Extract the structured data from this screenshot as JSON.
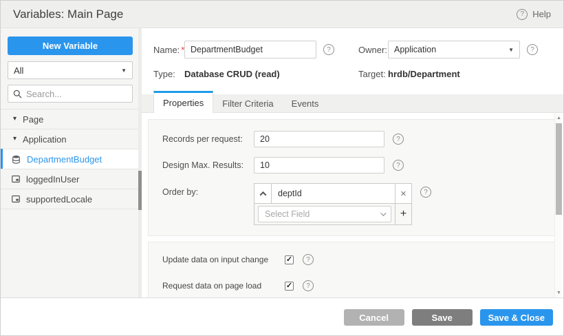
{
  "header": {
    "title": "Variables: Main Page",
    "help_label": "Help"
  },
  "icons": {
    "question": "?",
    "dropdown_arrow": "▼",
    "tree_expanded_arrow": "▾",
    "remove": "×",
    "add": "+",
    "check": "✓",
    "scroll_up": "▲",
    "scroll_down": "▼"
  },
  "sidebar": {
    "new_variable_button": "New Variable",
    "scope_filter_value": "All",
    "search_placeholder": "Search...",
    "tree": [
      {
        "label": "Page",
        "kind": "group",
        "expanded": true
      },
      {
        "label": "Application",
        "kind": "group",
        "expanded": true
      },
      {
        "label": "DepartmentBudget",
        "kind": "variable",
        "selected": true,
        "icon": "database-crud-variable-icon"
      },
      {
        "label": "loggedInUser",
        "kind": "variable",
        "selected": false,
        "icon": "static-variable-icon"
      },
      {
        "label": "supportedLocale",
        "kind": "variable",
        "selected": false,
        "icon": "static-variable-icon"
      }
    ]
  },
  "variable_form": {
    "name_label": "Name:",
    "name_required": "*",
    "name_value": "DepartmentBudget",
    "owner_label": "Owner:",
    "owner_required": "*",
    "owner_value": "Application",
    "type_label": "Type:",
    "type_value": "Database CRUD (read)",
    "target_label": "Target:",
    "target_value": "hrdb/Department"
  },
  "tabs": [
    {
      "label": "Properties",
      "active": true
    },
    {
      "label": "Filter Criteria",
      "active": false
    },
    {
      "label": "Events",
      "active": false
    }
  ],
  "properties_tab": {
    "records_per_request_label": "Records per request:",
    "records_per_request_value": "20",
    "design_max_results_label": "Design Max. Results:",
    "design_max_results_value": "10",
    "order_by_label": "Order by:",
    "order_by_field_value": "deptId",
    "order_by_select_placeholder": "Select Field",
    "update_data_on_input_change": {
      "label": "Update data on input change",
      "checked": true
    },
    "request_data_on_page_load": {
      "label": "Request data on page load",
      "checked": true
    }
  },
  "footer": {
    "cancel_label": "Cancel",
    "save_label": "Save",
    "save_and_close_label": "Save & Close"
  },
  "colors": {
    "accent_blue": "#2a95ec",
    "active_tab_border": "#1e9be9",
    "selected_item_text": "#2a95ec",
    "cancel_button_gray": "#b2b2b2",
    "save_button_gray": "#7e7e7e"
  }
}
